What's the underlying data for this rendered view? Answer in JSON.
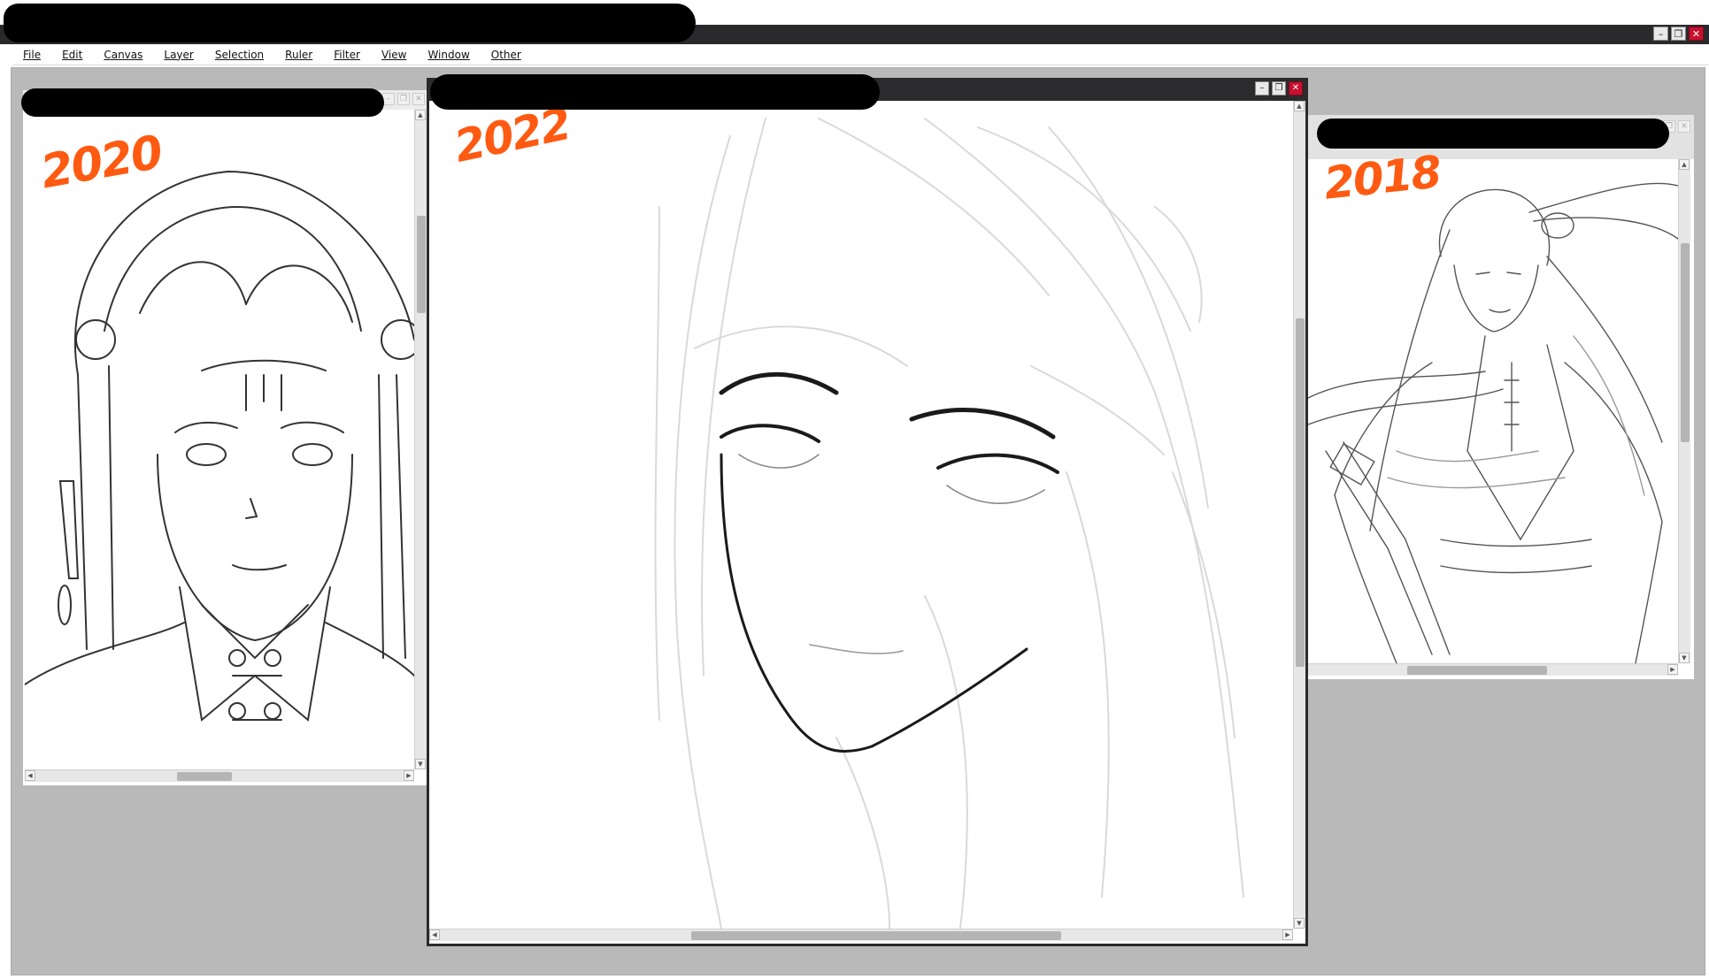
{
  "menu": {
    "items": [
      {
        "label": "File"
      },
      {
        "label": "Edit"
      },
      {
        "label": "Canvas"
      },
      {
        "label": "Layer"
      },
      {
        "label": "Selection"
      },
      {
        "label": "Ruler"
      },
      {
        "label": "Filter"
      },
      {
        "label": "View"
      },
      {
        "label": "Window"
      },
      {
        "label": "Other"
      }
    ]
  },
  "window_controls": {
    "minimize": "–",
    "restore": "❐",
    "close": "✕"
  },
  "documents": {
    "left": {
      "annotation": "2020"
    },
    "center": {
      "annotation": "2022"
    },
    "right": {
      "annotation": "2018"
    }
  },
  "colors": {
    "titlebar": "#2a2a2c",
    "workspace": "#b9b9b9",
    "annotation": "#ff5a12",
    "close_button": "#c8102e"
  }
}
